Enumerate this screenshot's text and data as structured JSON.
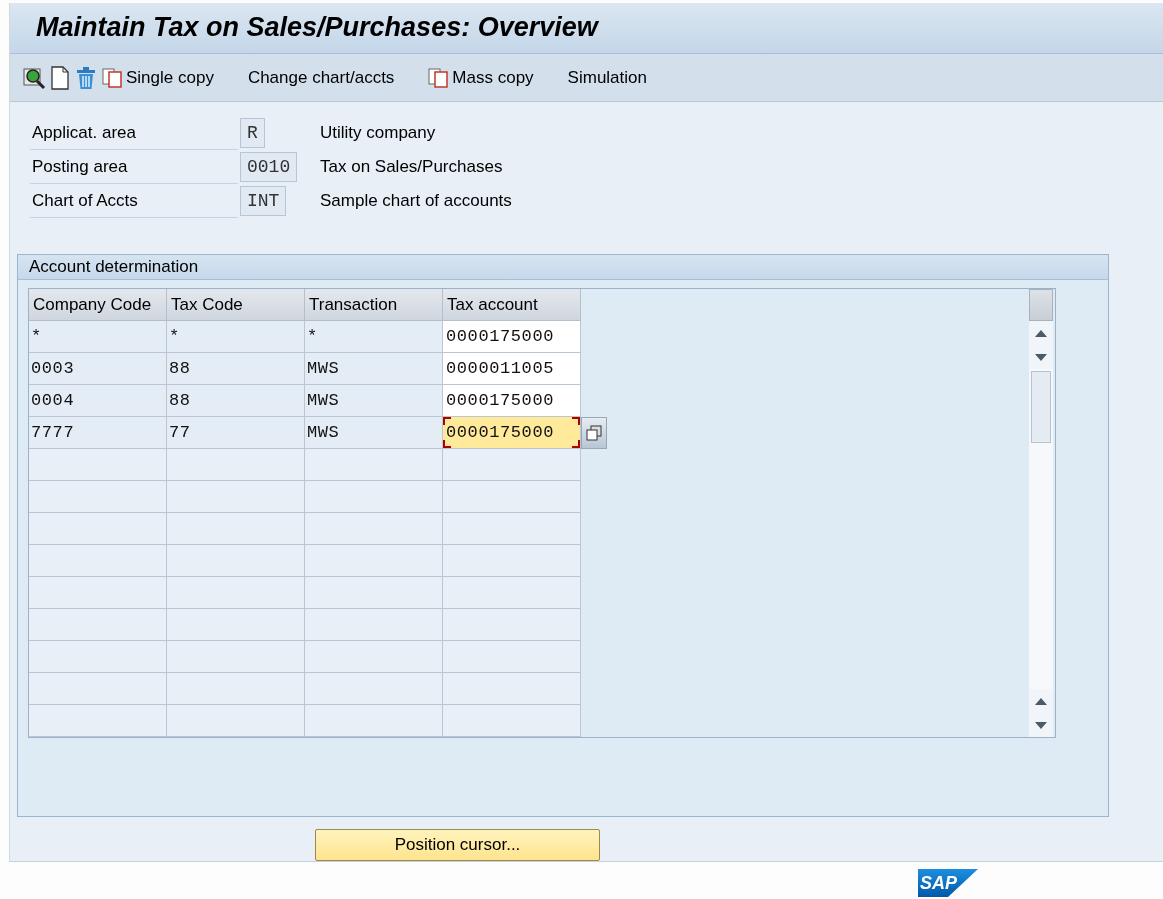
{
  "window": {
    "title": "Maintain Tax on Sales/Purchases: Overview"
  },
  "toolbar": [
    {
      "kind": "icon"
    },
    {
      "kind": "icon"
    },
    {
      "kind": "icon"
    },
    {
      "kind": "icon_text",
      "label": "Single copy"
    },
    {
      "kind": "text",
      "label": "Change chart/accts"
    },
    {
      "kind": "icon_text",
      "label": "Mass copy"
    },
    {
      "kind": "text",
      "label": "Simulation"
    }
  ],
  "header_fields": [
    {
      "label": "Applicat. area",
      "value": "R",
      "description": "Utility company"
    },
    {
      "label": "Posting area",
      "value": "0010",
      "description": "Tax on Sales/Purchases"
    },
    {
      "label": "Chart of Accts",
      "value": "INT",
      "description": "Sample chart of accounts"
    }
  ],
  "group": {
    "title": "Account determination",
    "table": {
      "columns": [
        "Company Code",
        "Tax Code",
        "Transaction",
        "Tax account"
      ],
      "rows": [
        {
          "cells": [
            "*",
            "*",
            "*",
            "0000175000"
          ],
          "focused": false
        },
        {
          "cells": [
            "0003",
            "88",
            "MWS",
            "0000011005"
          ],
          "focused": false
        },
        {
          "cells": [
            "0004",
            "88",
            "MWS",
            "0000175000"
          ],
          "focused": false
        },
        {
          "cells": [
            "7777",
            "77",
            "MWS",
            "0000175000"
          ],
          "focused": true
        }
      ]
    }
  },
  "button": {
    "label": "Position cursor..."
  },
  "logo": {
    "text": "SAP"
  }
}
